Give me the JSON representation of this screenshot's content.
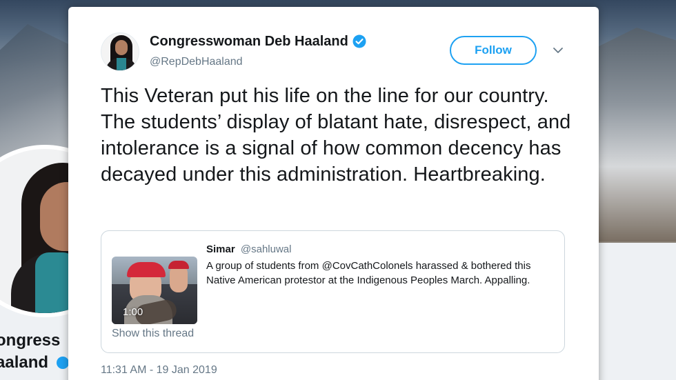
{
  "background": {
    "profile_name_lines": [
      "ongress",
      "aaland"
    ]
  },
  "tweet": {
    "display_name": "Congresswoman Deb Haaland",
    "handle": "@RepDebHaaland",
    "follow_label": "Follow",
    "text": "This Veteran put his life on the line for our country. The students’ display of blatant hate, disrespect, and intolerance is a signal of how common decency has decayed under this administration. Heartbreaking.",
    "timestamp": "11:31 AM - 19 Jan 2019",
    "colors": {
      "accent": "#1da1f2",
      "text": "#14171a",
      "muted": "#657786"
    }
  },
  "quoted": {
    "name": "Simar",
    "handle": "@sahluwal",
    "text": "A group of students from @CovCathColonels harassed & bothered this Native American protestor at the Indigenous Peoples March. Appalling.",
    "media_duration": "1:00",
    "show_thread_label": "Show this thread"
  },
  "icons": {
    "verified": "verified-badge-icon",
    "menu": "chevron-down-icon"
  }
}
